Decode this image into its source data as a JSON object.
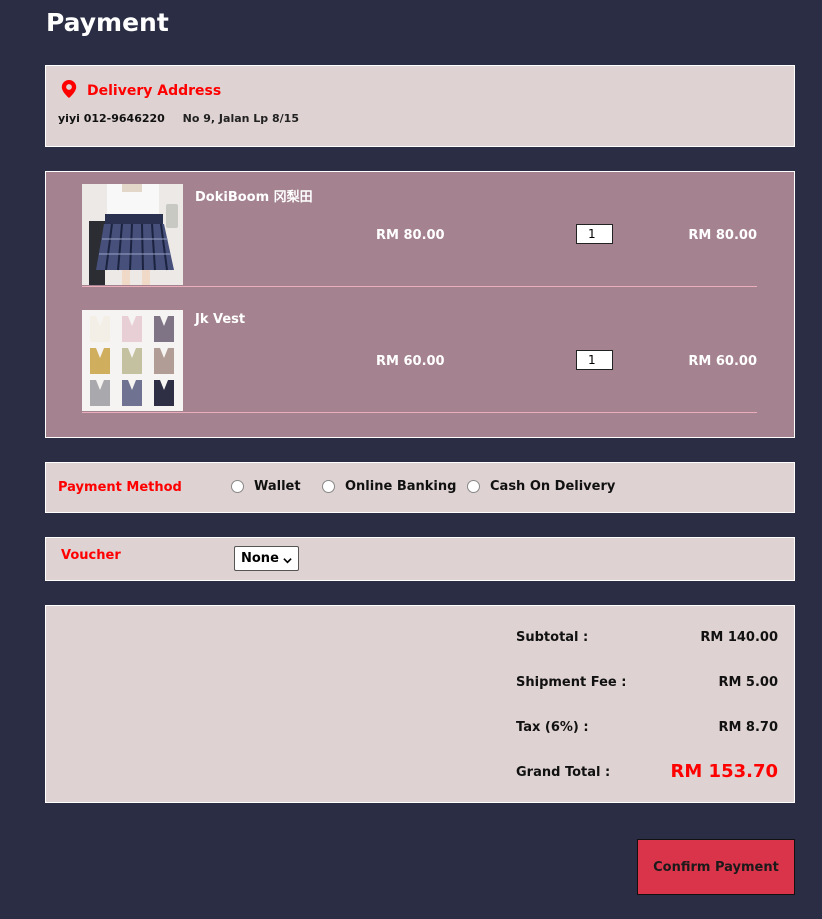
{
  "page": {
    "title": "Payment"
  },
  "address": {
    "heading": "Delivery Address",
    "name_phone": "yiyi 012-9646220",
    "street": "No 9, Jalan Lp 8/15"
  },
  "cart": {
    "items": [
      {
        "name": "DokiBoom 冈梨田",
        "price": "RM 80.00",
        "quantity": "1",
        "total": "RM 80.00",
        "thumb_icon": "plaid-skirt-photo"
      },
      {
        "name": "Jk Vest",
        "price": "RM 60.00",
        "quantity": "1",
        "total": "RM 60.00",
        "thumb_icon": "vest-grid-photo"
      }
    ]
  },
  "payment": {
    "label": "Payment Method",
    "options": [
      "Wallet",
      "Online Banking",
      "Cash On Delivery"
    ]
  },
  "voucher": {
    "label": "Voucher",
    "selected": "None"
  },
  "summary": {
    "subtotal_label": "Subtotal :",
    "subtotal_value": "RM 140.00",
    "shipment_label": "Shipment Fee :",
    "shipment_value": "RM 5.00",
    "tax_label": "Tax (6%) :",
    "tax_value": "RM 8.70",
    "grand_label": "Grand Total :",
    "grand_value": "RM 153.70"
  },
  "actions": {
    "confirm_label": "Confirm Payment"
  },
  "colors": {
    "background": "#2a2d43",
    "panel": "#dfd2d2",
    "cart_panel": "#a4828f",
    "accent_red": "#ff0000",
    "confirm_button": "#d9344a"
  }
}
